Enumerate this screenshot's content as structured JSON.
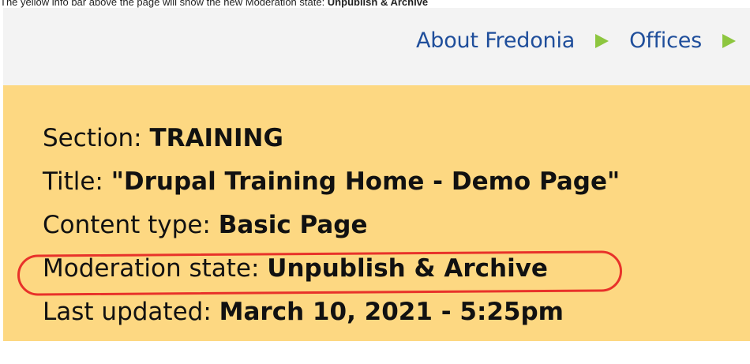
{
  "caption": {
    "prefix": "The yellow info bar above the page will show the new Moderation state: ",
    "emphasis": "Unpublish & Archive"
  },
  "breadcrumb": {
    "items": [
      {
        "label": "About Fredonia"
      },
      {
        "label": "Offices"
      }
    ]
  },
  "info_bar": {
    "section": {
      "label": "Section: ",
      "value": "TRAINING"
    },
    "title": {
      "label": "Title: ",
      "value": "\"Drupal Training Home - Demo Page\""
    },
    "content_type": {
      "label": "Content type: ",
      "value": "Basic Page"
    },
    "moderation_state": {
      "label": "Moderation state: ",
      "value": "Unpublish & Archive"
    },
    "last_updated": {
      "label": "Last updated: ",
      "value": "March 10, 2021 - 5:25pm"
    }
  },
  "colors": {
    "info_bar_bg": "#fdd882",
    "link": "#1f4e9b",
    "separator": "#8dc63f",
    "highlight": "#e8322a"
  }
}
